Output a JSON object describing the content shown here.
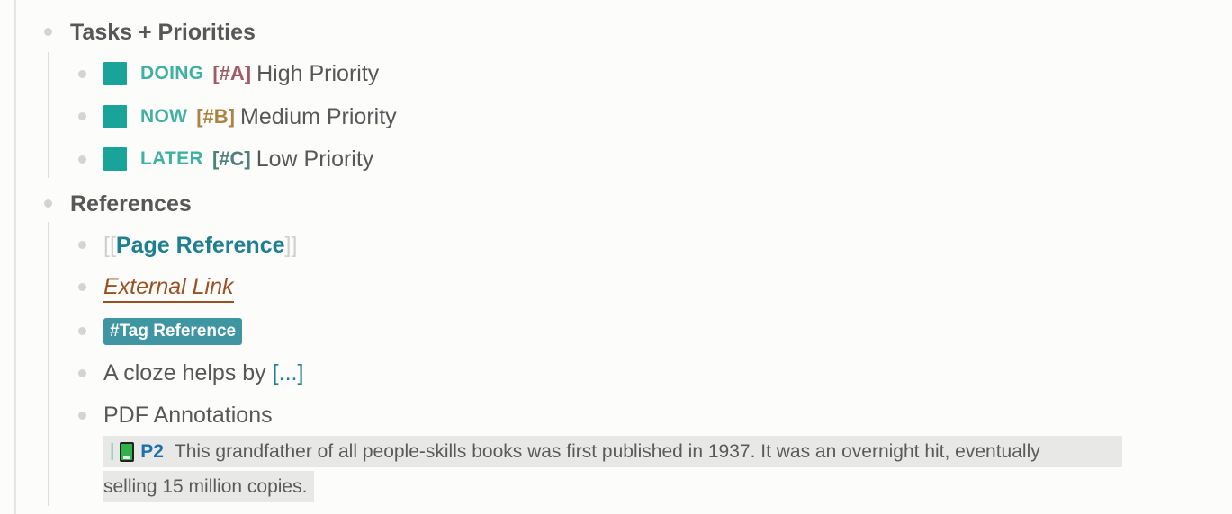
{
  "sections": {
    "tasks": {
      "title": "Tasks + Priorities",
      "items": [
        {
          "marker": "DOING",
          "priority": "[#A]",
          "text": "High Priority"
        },
        {
          "marker": "NOW",
          "priority": "[#B]",
          "text": "Medium Priority"
        },
        {
          "marker": "LATER",
          "priority": "[#C]",
          "text": "Low Priority"
        }
      ]
    },
    "references": {
      "title": "References",
      "page_ref": {
        "open": "[[",
        "label": "Page Reference",
        "close": "]]"
      },
      "external_link": "External Link",
      "tag": "#Tag Reference",
      "cloze": {
        "text": "A cloze helps by",
        "placeholder": "[...]"
      },
      "pdf": {
        "title": "PDF Annotations",
        "pipe": "|",
        "page": "P2",
        "highlight_line1": "This grandfather of all people-skills books was first published in 1937. It was an overnight hit, eventually",
        "highlight_line2": "selling 15 million copies."
      }
    }
  },
  "colors": {
    "checkbox": "#1aa399",
    "marker": "#3fb0a2",
    "priority_a": "#a15a67",
    "priority_b": "#a98444",
    "priority_c": "#4e7f7d",
    "link": "#1f7f91",
    "external": "#9a5122",
    "tag_bg": "#3f95a2",
    "highlight_bg": "#e8e8e6"
  },
  "icons": {
    "pdf_page": "green-book-icon"
  }
}
